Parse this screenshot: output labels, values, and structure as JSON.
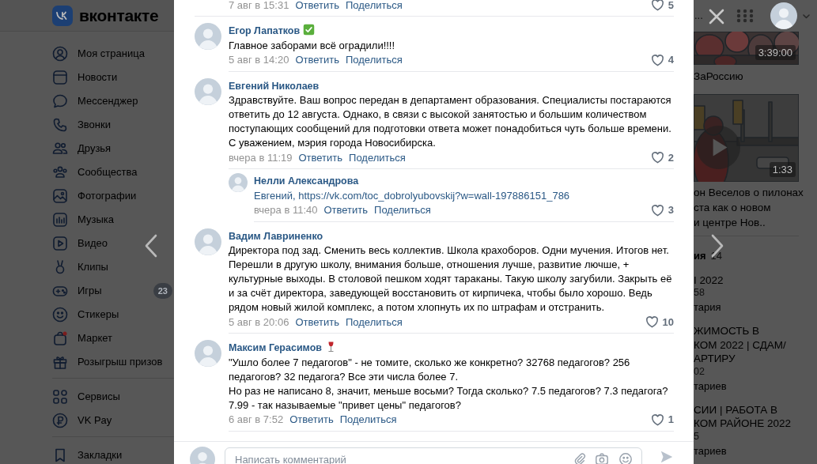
{
  "header": {
    "logo_text": "вконтакте"
  },
  "sidebar": {
    "groups": [
      {
        "items": [
          {
            "label": "Моя страница"
          },
          {
            "label": "Новости"
          },
          {
            "label": "Мессенджер"
          },
          {
            "label": "Звонки"
          },
          {
            "label": "Друзья"
          },
          {
            "label": "Сообщества"
          },
          {
            "label": "Фотографии"
          },
          {
            "label": "Музыка"
          },
          {
            "label": "Видео"
          },
          {
            "label": "Клипы"
          },
          {
            "label": "Игры",
            "badge": "23"
          },
          {
            "label": "Стикеры"
          },
          {
            "label": "Маркет"
          },
          {
            "label": "Розыгрыш призов"
          }
        ]
      },
      {
        "items": [
          {
            "label": "Сервисы"
          },
          {
            "label": "VK Pay"
          }
        ]
      },
      {
        "items": [
          {
            "label": "Закладки"
          }
        ]
      }
    ]
  },
  "comments": [
    {
      "date": "7 авг в 15:31",
      "reply": "Ответить",
      "share": "Поделиться",
      "likes": "5"
    },
    {
      "author": "Егор Лапатков",
      "kind": "verified",
      "text": "Главное заборами всё оградили!!!!",
      "date": "5 авг в 14:20",
      "reply": "Ответить",
      "share": "Поделиться",
      "likes": "4"
    },
    {
      "author": "Евгений Николаев",
      "text": "Здравствуйте. Ваш вопрос передан в департамент образования. Специалисты постараются ответить до 12 августа. Однако, в связи с высокой занятостью и большим количеством поступающих сообщений для подготовки ответа может понадобиться чуть больше времени. С уважением, мэрия города Новосибирска.",
      "date": "вчера в 11:19",
      "reply": "Ответить",
      "share": "Поделиться",
      "likes": "2",
      "replies": [
        {
          "author": "Нелли Александрова",
          "parts": [
            "Евгений,",
            "https://vk.com/toc_dobrolyubovskij?w=wall-197886151_786"
          ],
          "date": "вчера в 11:40",
          "reply": "Ответить",
          "share": "Поделиться",
          "likes": "3"
        }
      ]
    },
    {
      "author": "Вадим Лавриненко",
      "text": "Директора под зад. Сменить весь коллектив. Школа крахоборов. Одни мучения. Итогов нет. Перешли в другую школу, внимания больше, отношения лучше, развитие лючше, + культурные выходы. В столовой пешком ходят тараканы. Такую школу загубили. Закрыть её и за счёт директора, заведующей восстановить от кирпичека, чтобы было хорошо. Ведь рядом новый жилой комплекс, а потом хлопнуть их по штрафам и отстранить.",
      "date": "5 авг в 20:06",
      "reply": "Ответить",
      "share": "Поделиться",
      "likes": "10"
    },
    {
      "author": "Максим Герасимов",
      "kind": "wine",
      "text": "\"Ушло более 7 педагогов\" - не томите, сколько же конкретно? 32768 педагогов? 256 педагогов? 32 педагога? Все эти числа более 7.\nНо раз не написано 8, значит, меньше восьми? Тогда сколько? 7.5 педагогов? 7.3 педагога? 7.99 - так называемые \"привет цены\" педагогов?",
      "date": "6 авг в 7:52",
      "reply": "Ответить",
      "share": "Поделиться",
      "likes": "1"
    }
  ],
  "composer": {
    "placeholder": "Написать комментарий"
  },
  "right_panel": {
    "top_text": "...",
    "videos": [
      {
        "duration": "3:39:00",
        "title": "ЗаРоссию"
      },
      {
        "duration": "1:33",
        "title": "он Веселов о пилонах\nста как о новом\nи центре Нов.."
      }
    ],
    "section": {
      "title": "ия",
      "count": "14"
    },
    "posts": [
      {
        "title": "I 2022",
        "meta": "58",
        "comments": "тария"
      },
      {
        "title": "ЖИМОСТЬ В\nКОМ 2022 | СДАМ/\nАРТИРУ",
        "meta": "02",
        "comments": "тариев"
      },
      {
        "title": "СИИ | РАБОТА В\nКОМ РАЙОНЕ 2022",
        "meta": "5",
        "comments": "тариев"
      }
    ]
  }
}
